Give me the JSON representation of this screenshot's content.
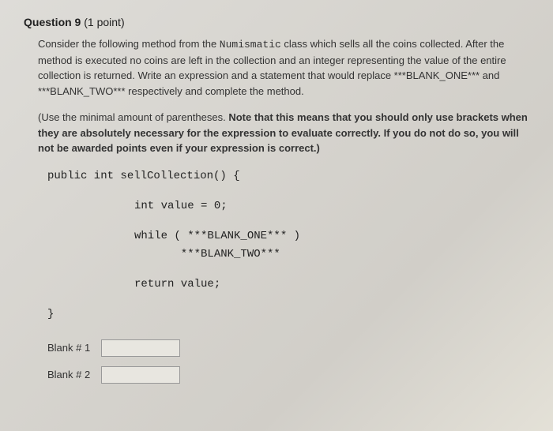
{
  "header": {
    "question_label": "Question 9",
    "points": "(1 point)"
  },
  "body": {
    "para1_a": "Consider the following method from the ",
    "para1_class": "Numismatic",
    "para1_b": " class which sells all the coins collected. After the method is executed no coins are left in the collection and an integer representing the value of the entire collection is returned. Write an expression and a statement that would replace ***BLANK_ONE*** and ***BLANK_TWO*** respectively and complete the method.",
    "note_a": "(Use the minimal amount of parentheses. ",
    "note_bold": "Note that this means that you should only use brackets when they are absolutely necessary for the expression to evaluate correctly. If you do not do so, you will not be awarded points even if your expression is correct.)",
    "code": {
      "sig": "public int sellCollection() {",
      "l1": "int value = 0;",
      "l2": "while ( ***BLANK_ONE*** )",
      "l3": "       ***BLANK_TWO***",
      "l4": "return value;",
      "close": "}"
    }
  },
  "blanks": {
    "b1_label": "Blank # 1",
    "b2_label": "Blank # 2",
    "b1_value": "",
    "b2_value": ""
  }
}
